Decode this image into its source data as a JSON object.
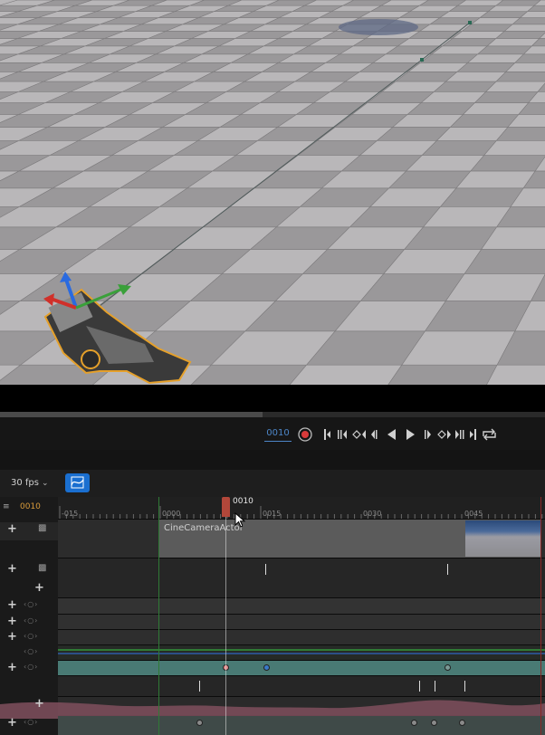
{
  "viewport": {
    "floor_colors": {
      "light": "#b9b7b9",
      "dark": "#9a989a",
      "line": "#7d7b7d"
    },
    "camera_outline_color": "#e5a02a"
  },
  "transport": {
    "current_frame": "0010",
    "icons": [
      "record-icon",
      "jump-start-icon",
      "prev-key-icon",
      "prev-frame-icon",
      "play-reverse-icon",
      "play-icon",
      "next-frame-icon",
      "next-key-icon",
      "jump-end-icon",
      "loop-icon"
    ]
  },
  "sequencer": {
    "fps_label": "30 fps",
    "current_frame_label": "0010",
    "playhead_label": "0010",
    "ruler_ticks": [
      "-015",
      "0000",
      "0015",
      "0030",
      "0045"
    ],
    "camera_track_label": "CineCameraActor"
  },
  "colors": {
    "accent": "#1a6fd0",
    "playhead": "#b2473a",
    "start": "#2f7a35",
    "end": "#8a2727",
    "current_frame": "#d89a3a"
  }
}
